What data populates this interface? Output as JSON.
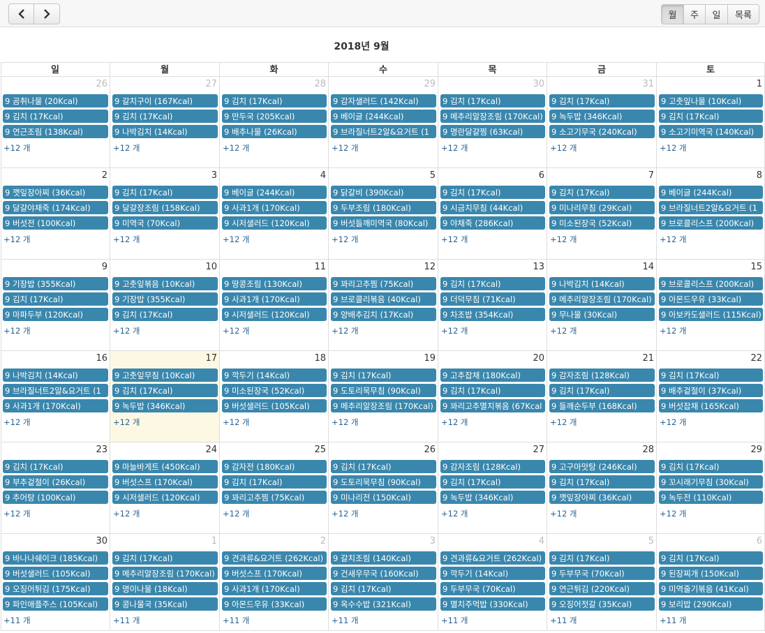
{
  "toolbar": {
    "prev_icon": "chevron-left-icon",
    "next_icon": "chevron-right-icon",
    "views": [
      "월",
      "주",
      "일",
      "목록"
    ],
    "active_view": "월"
  },
  "title": "2018년 9월",
  "weekdays": [
    "일",
    "월",
    "화",
    "수",
    "목",
    "금",
    "토"
  ],
  "accent_color": "#3a87ad",
  "today_color": "#fcf8e3",
  "weeks": [
    [
      {
        "day": "26",
        "other": true,
        "events": [
          "9 곰취나물 (20Kcal)",
          "9 김치 (17Kcal)",
          "9 연근조림 (138Kcal)"
        ],
        "more": "+12 개"
      },
      {
        "day": "27",
        "other": true,
        "events": [
          "9 갈치구이 (167Kcal)",
          "9 김치 (17Kcal)",
          "9 나박김치 (14Kcal)"
        ],
        "more": "+12 개"
      },
      {
        "day": "28",
        "other": true,
        "events": [
          "9 김치 (17Kcal)",
          "9 만두국 (205Kcal)",
          "9 배추나물 (26Kcal)"
        ],
        "more": "+12 개"
      },
      {
        "day": "29",
        "other": true,
        "events": [
          "9 감자샐러드 (142Kcal)",
          "9 베이글 (244Kcal)",
          "9 브라질너트2알&요거트 (1"
        ],
        "more": "+12 개"
      },
      {
        "day": "30",
        "other": true,
        "events": [
          "9 김치 (17Kcal)",
          "9 메추리알장조림 (170Kcal)",
          "9 명란달걀찜 (63Kcal)"
        ],
        "more": "+12 개"
      },
      {
        "day": "31",
        "other": true,
        "events": [
          "9 김치 (17Kcal)",
          "9 녹두밥 (346Kcal)",
          "9 소고기무국 (240Kcal)"
        ],
        "more": "+12 개"
      },
      {
        "day": "1",
        "other": false,
        "events": [
          "9 고춧잎나물 (10Kcal)",
          "9 김치 (17Kcal)",
          "9 소고기미역국 (140Kcal)"
        ],
        "more": "+12 개"
      }
    ],
    [
      {
        "day": "2",
        "other": false,
        "events": [
          "9 깻잎장아찌 (36Kcal)",
          "9 달걀야채죽 (174Kcal)",
          "9 버섯전 (100Kcal)"
        ],
        "more": "+12 개"
      },
      {
        "day": "3",
        "other": false,
        "events": [
          "9 김치 (17Kcal)",
          "9 달걀장조림 (158Kcal)",
          "9 미역국 (70Kcal)"
        ],
        "more": "+12 개"
      },
      {
        "day": "4",
        "other": false,
        "events": [
          "9 베이글 (244Kcal)",
          "9 사과1개 (170Kcal)",
          "9 시저샐러드 (120Kcal)"
        ],
        "more": "+12 개"
      },
      {
        "day": "5",
        "other": false,
        "events": [
          "9 닭갈비 (390Kcal)",
          "9 두부조림 (180Kcal)",
          "9 버섯들깨미역국 (80Kcal)"
        ],
        "more": "+12 개"
      },
      {
        "day": "6",
        "other": false,
        "events": [
          "9 김치 (17Kcal)",
          "9 시금치무침 (44Kcal)",
          "9 야채죽 (286Kcal)"
        ],
        "more": "+12 개"
      },
      {
        "day": "7",
        "other": false,
        "events": [
          "9 김치 (17Kcal)",
          "9 미나리무침 (29Kcal)",
          "9 미소된장국 (52Kcal)"
        ],
        "more": "+12 개"
      },
      {
        "day": "8",
        "other": false,
        "events": [
          "9 베이글 (244Kcal)",
          "9 브라질너트2알&요거트 (1",
          "9 브로콜리스프 (200Kcal)"
        ],
        "more": "+12 개"
      }
    ],
    [
      {
        "day": "9",
        "other": false,
        "events": [
          "9 기장밥 (355Kcal)",
          "9 김치 (17Kcal)",
          "9 마파두부 (120Kcal)"
        ],
        "more": "+12 개"
      },
      {
        "day": "10",
        "other": false,
        "events": [
          "9 고춧잎볶음 (10Kcal)",
          "9 기장밥 (355Kcal)",
          "9 김치 (17Kcal)"
        ],
        "more": "+12 개"
      },
      {
        "day": "11",
        "other": false,
        "events": [
          "9 땅콩조림 (130Kcal)",
          "9 사과1개 (170Kcal)",
          "9 시저샐러드 (120Kcal)"
        ],
        "more": "+12 개"
      },
      {
        "day": "12",
        "other": false,
        "events": [
          "9 꽈리고추찜 (75Kcal)",
          "9 브로콜리볶음 (40Kcal)",
          "9 양배추김치 (17Kcal)"
        ],
        "more": "+12 개"
      },
      {
        "day": "13",
        "other": false,
        "events": [
          "9 김치 (17Kcal)",
          "9 더덕무침 (71Kcal)",
          "9 차조밥 (354Kcal)"
        ],
        "more": "+12 개"
      },
      {
        "day": "14",
        "other": false,
        "events": [
          "9 나박김치 (14Kcal)",
          "9 메추리알장조림 (170Kcal)",
          "9 무나물 (30Kcal)"
        ],
        "more": "+12 개"
      },
      {
        "day": "15",
        "other": false,
        "events": [
          "9 브로콜리스프 (200Kcal)",
          "9 아몬드우유 (33Kcal)",
          "9 아보카도샐러드 (115Kcal)"
        ],
        "more": "+12 개"
      }
    ],
    [
      {
        "day": "16",
        "other": false,
        "events": [
          "9 나박김치 (14Kcal)",
          "9 브라질너트2알&요거트 (1",
          "9 사과1개 (170Kcal)"
        ],
        "more": "+12 개"
      },
      {
        "day": "17",
        "other": false,
        "today": true,
        "events": [
          "9 고춧잎무침 (10Kcal)",
          "9 김치 (17Kcal)",
          "9 녹두밥 (346Kcal)"
        ],
        "more": "+12 개"
      },
      {
        "day": "18",
        "other": false,
        "events": [
          "9 깍두기 (14Kcal)",
          "9 미소된장국 (52Kcal)",
          "9 버섯샐러드 (105Kcal)"
        ],
        "more": "+12 개"
      },
      {
        "day": "19",
        "other": false,
        "events": [
          "9 김치 (17Kcal)",
          "9 도토리묵무침 (90Kcal)",
          "9 메추리알장조림 (170Kcal)"
        ],
        "more": "+12 개"
      },
      {
        "day": "20",
        "other": false,
        "events": [
          "9 고추잡채 (180Kcal)",
          "9 김치 (17Kcal)",
          "9 꽈리고추멸치볶음 (67Kcal"
        ],
        "more": "+12 개"
      },
      {
        "day": "21",
        "other": false,
        "events": [
          "9 감자조림 (128Kcal)",
          "9 김치 (17Kcal)",
          "9 들깨순두부 (168Kcal)"
        ],
        "more": "+12 개"
      },
      {
        "day": "22",
        "other": false,
        "events": [
          "9 김치 (17Kcal)",
          "9 배추겉절이 (37Kcal)",
          "9 버섯잡채 (165Kcal)"
        ],
        "more": "+12 개"
      }
    ],
    [
      {
        "day": "23",
        "other": false,
        "events": [
          "9 김치 (17Kcal)",
          "9 부추겉절이 (26Kcal)",
          "9 추어탕 (100Kcal)"
        ],
        "more": "+12 개"
      },
      {
        "day": "24",
        "other": false,
        "events": [
          "9 마늘바게트 (450Kcal)",
          "9 버섯스프 (170Kcal)",
          "9 시저샐러드 (120Kcal)"
        ],
        "more": "+12 개"
      },
      {
        "day": "25",
        "other": false,
        "events": [
          "9 감자전 (180Kcal)",
          "9 김치 (17Kcal)",
          "9 꽈리고추찜 (75Kcal)"
        ],
        "more": "+12 개"
      },
      {
        "day": "26",
        "other": false,
        "events": [
          "9 김치 (17Kcal)",
          "9 도토리묵무침 (90Kcal)",
          "9 미나리전 (150Kcal)"
        ],
        "more": "+12 개"
      },
      {
        "day": "27",
        "other": false,
        "events": [
          "9 감자조림 (128Kcal)",
          "9 김치 (17Kcal)",
          "9 녹두밥 (346Kcal)"
        ],
        "more": "+12 개"
      },
      {
        "day": "28",
        "other": false,
        "events": [
          "9 고구마맛탕 (246Kcal)",
          "9 김치 (17Kcal)",
          "9 깻잎장아찌 (36Kcal)"
        ],
        "more": "+12 개"
      },
      {
        "day": "29",
        "other": false,
        "events": [
          "9 김치 (17Kcal)",
          "9 꼬시래기무침 (30Kcal)",
          "9 녹두전 (110Kcal)"
        ],
        "more": "+12 개"
      }
    ],
    [
      {
        "day": "30",
        "other": false,
        "events": [
          "9 바나나쉐이크 (185Kcal)",
          "9 버섯샐러드 (105Kcal)",
          "9 오징어튀김 (175Kcal)",
          "9 파인애플주스 (105Kcal)"
        ],
        "more": "+11 개"
      },
      {
        "day": "1",
        "other": true,
        "events": [
          "9 김치 (17Kcal)",
          "9 메추리알장조림 (170Kcal)",
          "9 명이나물 (18Kcal)",
          "9 콩나물국 (35Kcal)"
        ],
        "more": "+11 개"
      },
      {
        "day": "2",
        "other": true,
        "events": [
          "9 견과류&요거트 (262Kcal)",
          "9 버섯스프 (170Kcal)",
          "9 사과1개 (170Kcal)",
          "9 아몬드우유 (33Kcal)"
        ],
        "more": "+11 개"
      },
      {
        "day": "3",
        "other": true,
        "events": [
          "9 갈치조림 (140Kcal)",
          "9 건새우무국 (160Kcal)",
          "9 김치 (17Kcal)",
          "9 옥수수밥 (321Kcal)"
        ],
        "more": "+11 개"
      },
      {
        "day": "4",
        "other": true,
        "events": [
          "9 견과류&요거트 (262Kcal)",
          "9 깍두기 (14Kcal)",
          "9 두부무국 (70Kcal)",
          "9 멸치주먹밥 (330Kcal)"
        ],
        "more": "+11 개"
      },
      {
        "day": "5",
        "other": true,
        "events": [
          "9 김치 (17Kcal)",
          "9 두부무국 (70Kcal)",
          "9 연근튀김 (220Kcal)",
          "9 오징어젓갈 (35Kcal)"
        ],
        "more": "+11 개"
      },
      {
        "day": "6",
        "other": true,
        "events": [
          "9 김치 (17Kcal)",
          "9 된장찌개 (150Kcal)",
          "9 미역줄기볶음 (41Kcal)",
          "9 보리밥 (290Kcal)"
        ],
        "more": "+11 개"
      }
    ]
  ]
}
